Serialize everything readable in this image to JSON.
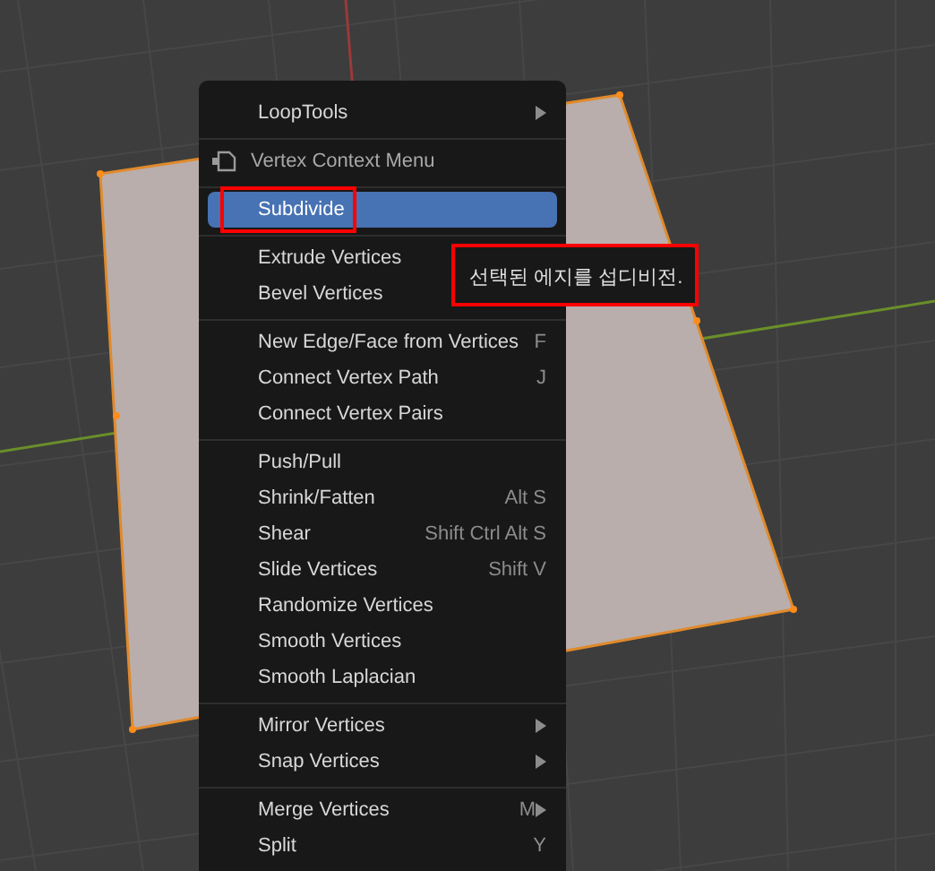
{
  "menu": {
    "sections": [
      [
        {
          "kind": "item",
          "label": "LoopTools",
          "submenu": true,
          "selected": false
        }
      ],
      [
        {
          "kind": "header",
          "label": "Vertex Context Menu"
        }
      ],
      [
        {
          "kind": "item",
          "label": "Subdivide",
          "selected": true,
          "highlighted": true
        }
      ],
      [
        {
          "kind": "item",
          "label": "Extrude Vertices",
          "selected": false
        },
        {
          "kind": "item",
          "label": "Bevel Vertices",
          "selected": false
        }
      ],
      [
        {
          "kind": "item",
          "label": "New Edge/Face from Vertices",
          "shortcut": "F",
          "selected": false
        },
        {
          "kind": "item",
          "label": "Connect Vertex Path",
          "shortcut": "J",
          "selected": false
        },
        {
          "kind": "item",
          "label": "Connect Vertex Pairs",
          "selected": false
        }
      ],
      [
        {
          "kind": "item",
          "label": "Push/Pull",
          "selected": false
        },
        {
          "kind": "item",
          "label": "Shrink/Fatten",
          "shortcut": "Alt S",
          "selected": false
        },
        {
          "kind": "item",
          "label": "Shear",
          "shortcut": "Shift Ctrl Alt S",
          "selected": false
        },
        {
          "kind": "item",
          "label": "Slide Vertices",
          "shortcut": "Shift V",
          "selected": false
        },
        {
          "kind": "item",
          "label": "Randomize Vertices",
          "selected": false
        },
        {
          "kind": "item",
          "label": "Smooth Vertices",
          "selected": false
        },
        {
          "kind": "item",
          "label": "Smooth Laplacian",
          "selected": false
        }
      ],
      [
        {
          "kind": "item",
          "label": "Mirror Vertices",
          "submenu": true,
          "selected": false
        },
        {
          "kind": "item",
          "label": "Snap Vertices",
          "submenu": true,
          "selected": false
        }
      ],
      [
        {
          "kind": "item",
          "label": "Merge Vertices",
          "shortcut": "M",
          "submenu": true,
          "selected": false
        },
        {
          "kind": "item",
          "label": "Split",
          "shortcut": "Y",
          "selected": false
        }
      ]
    ]
  },
  "tooltip": {
    "text": "선택된 에지를 섭디비전.",
    "highlighted": true
  }
}
